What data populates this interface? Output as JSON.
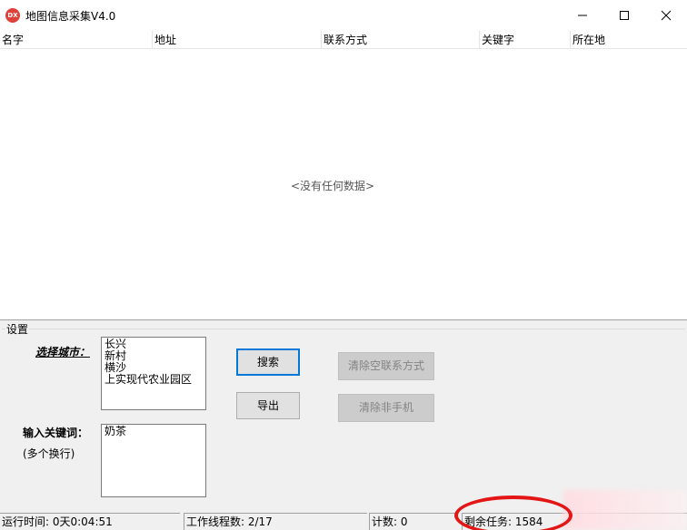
{
  "window": {
    "icon_text": "DX",
    "title": "地图信息采集V4.0"
  },
  "list": {
    "columns": [
      "名字",
      "地址",
      "联系方式",
      "关键字",
      "所在地"
    ],
    "empty_message": "<没有任何数据>"
  },
  "settings": {
    "group_title": "设置",
    "city_label": "选择城市：",
    "cities_text": "长兴\n新村\n横沙\n上实现代农业园区",
    "keyword_label": "输入关键词：",
    "keyword_hint": "(多个换行)",
    "keywords_text": "奶茶",
    "search_button": "搜索",
    "export_button": "导出",
    "clear_empty_button": "清除空联系方式",
    "clear_nonmobile_button": "清除非手机"
  },
  "status": {
    "run_time": "运行时间: 0天0:04:51",
    "threads": "工作线程数: 2/17",
    "count": "计数: 0",
    "remaining": "剩余任务: 1584"
  },
  "colors": {
    "app_icon": "#e0403a",
    "highlight_circle": "#e31515",
    "focus_border": "#0078d7"
  }
}
